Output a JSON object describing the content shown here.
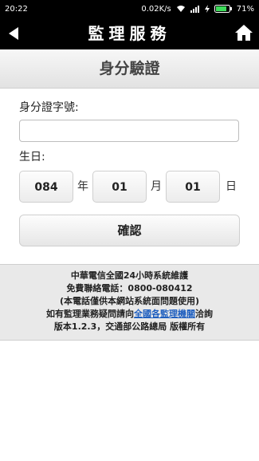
{
  "status_bar": {
    "time": "20:22",
    "speed": "0.02K/s",
    "battery": "71%"
  },
  "header": {
    "title": "監理服務"
  },
  "page": {
    "heading": "身分驗證"
  },
  "form": {
    "id_label": "身分證字號:",
    "id_value": "",
    "birthday_label": "生日:",
    "year_value": "084",
    "year_unit": "年",
    "month_value": "01",
    "month_unit": "月",
    "day_value": "01",
    "day_unit": "日",
    "confirm_label": "確認"
  },
  "footer": {
    "line1": "中華電信全國24小時系統維護",
    "line2": "免費聯絡電話：0800-080412",
    "line3": "(本電話僅供本網站系統面問題使用)",
    "line4_prefix": "如有監理業務疑問請向",
    "line4_link": "全國各監理機關",
    "line4_suffix": "洽詢",
    "line5": "版本1.2.3，交通部公路總局 版權所有"
  },
  "colors": {
    "header_bg": "#000000",
    "link": "#1f5fbf",
    "footer_bg": "#e9e9e9"
  }
}
